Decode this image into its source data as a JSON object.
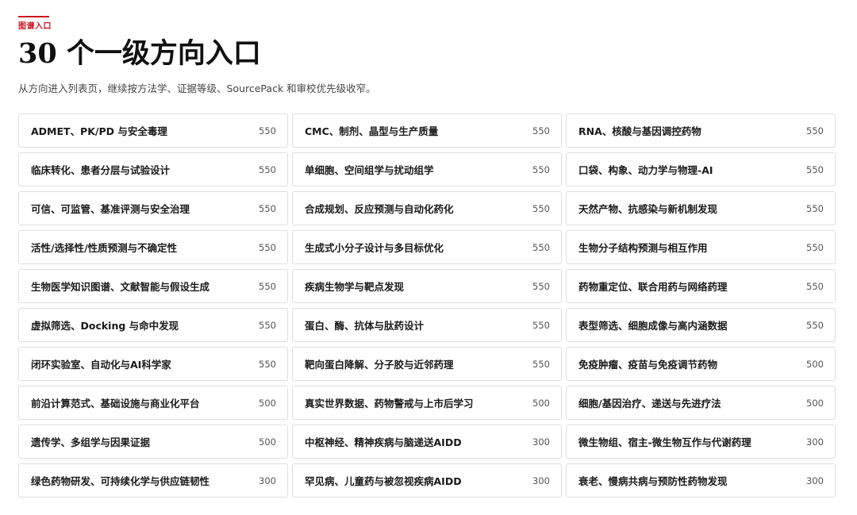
{
  "section": {
    "eyebrow": "图谱入口",
    "title": "30 个一级方向入口",
    "subtitle": "从方向进入列表页，继续按方法学、证据等级、SourcePack 和审校优先级收窄。"
  },
  "colors": {
    "accent": "#c8141e",
    "border": "#dedede",
    "text": "#1a1a1a",
    "muted": "#555555"
  },
  "directions": [
    {
      "label": "ADMET、PK/PD 与安全毒理",
      "count": "550"
    },
    {
      "label": "CMC、制剂、晶型与生产质量",
      "count": "550"
    },
    {
      "label": "RNA、核酸与基因调控药物",
      "count": "550"
    },
    {
      "label": "临床转化、患者分层与试验设计",
      "count": "550"
    },
    {
      "label": "单细胞、空间组学与扰动组学",
      "count": "550"
    },
    {
      "label": "口袋、构象、动力学与物理-AI",
      "count": "550"
    },
    {
      "label": "可信、可监管、基准评测与安全治理",
      "count": "550"
    },
    {
      "label": "合成规划、反应预测与自动化药化",
      "count": "550"
    },
    {
      "label": "天然产物、抗感染与新机制发现",
      "count": "550"
    },
    {
      "label": "活性/选择性/性质预测与不确定性",
      "count": "550"
    },
    {
      "label": "生成式小分子设计与多目标优化",
      "count": "550"
    },
    {
      "label": "生物分子结构预测与相互作用",
      "count": "550"
    },
    {
      "label": "生物医学知识图谱、文献智能与假设生成",
      "count": "550"
    },
    {
      "label": "疾病生物学与靶点发现",
      "count": "550"
    },
    {
      "label": "药物重定位、联合用药与网络药理",
      "count": "550"
    },
    {
      "label": "虚拟筛选、Docking 与命中发现",
      "count": "550"
    },
    {
      "label": "蛋白、酶、抗体与肽药设计",
      "count": "550"
    },
    {
      "label": "表型筛选、细胞成像与高内涵数据",
      "count": "550"
    },
    {
      "label": "闭环实验室、自动化与AI科学家",
      "count": "550"
    },
    {
      "label": "靶向蛋白降解、分子胶与近邻药理",
      "count": "550"
    },
    {
      "label": "免疫肿瘤、疫苗与免疫调节药物",
      "count": "500"
    },
    {
      "label": "前沿计算范式、基础设施与商业化平台",
      "count": "500"
    },
    {
      "label": "真实世界数据、药物警戒与上市后学习",
      "count": "500"
    },
    {
      "label": "细胞/基因治疗、递送与先进疗法",
      "count": "500"
    },
    {
      "label": "遗传学、多组学与因果证据",
      "count": "500"
    },
    {
      "label": "中枢神经、精神疾病与脑递送AIDD",
      "count": "300"
    },
    {
      "label": "微生物组、宿主-微生物互作与代谢药理",
      "count": "300"
    },
    {
      "label": "绿色药物研发、可持续化学与供应链韧性",
      "count": "300"
    },
    {
      "label": "罕见病、儿童药与被忽视疾病AIDD",
      "count": "300"
    },
    {
      "label": "衰老、慢病共病与预防性药物发现",
      "count": "300"
    }
  ]
}
